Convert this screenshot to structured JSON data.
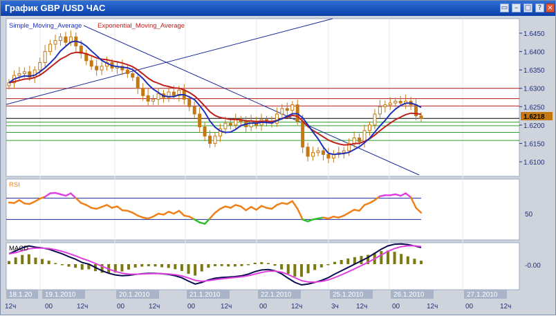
{
  "window": {
    "title": "График GBP /USD  ЧАС",
    "buttons": [
      "restore-window-icon",
      "minimize-window-icon",
      "maximize-window-icon",
      "help-icon",
      "close-window-icon"
    ]
  },
  "main_panel": {
    "legend_sma": "Simple_Moving_Average",
    "legend_ema": "Exponential_Moving_Average",
    "price_ticks": [
      "1.6450",
      "1.6400",
      "1.6350",
      "1.6300",
      "1.6250",
      "1.6200",
      "1.6150",
      "1.6100"
    ],
    "current_price": "1.6218",
    "sma_color": "#1f2fb8",
    "ema_color": "#c0201c",
    "candle_color": "#c47812",
    "red_levels": [
      1.63,
      1.6272,
      1.6252
    ],
    "green_levels": [
      1.6208,
      1.6198,
      1.618,
      1.6158
    ]
  },
  "rsi_panel": {
    "label": "RSI",
    "tick": "50",
    "upper_level": 72,
    "lower_level": 28,
    "overbought_color": "#e040e0",
    "oversold_color": "#30c030",
    "line_color": "#f08018"
  },
  "macd_panel": {
    "label": "MACD",
    "tick": "-0.00",
    "hist_color": "#7a7a10"
  },
  "time_axis": {
    "dates": [
      "18.1.20",
      "19.1.2010",
      "20.1.2010",
      "21.1.2010",
      "22.1.2010",
      "25.1.2010",
      "26.1.2010",
      "27.1.2010"
    ],
    "hours": [
      "12ч",
      "00",
      "12ч",
      "00",
      "12ч",
      "00",
      "12ч",
      "00",
      "12ч",
      "3ч",
      "12ч",
      "00",
      "12ч",
      "00",
      "12ч"
    ]
  },
  "chart_data": {
    "type": "line",
    "instrument": "GBP/USD",
    "close": [
      1.6315,
      1.6335,
      1.634,
      1.6345,
      1.633,
      1.635,
      1.637,
      1.64,
      1.642,
      1.643,
      1.644,
      1.6425,
      1.644,
      1.6415,
      1.6395,
      1.6375,
      1.636,
      1.635,
      1.636,
      1.637,
      1.6355,
      1.636,
      1.635,
      1.634,
      1.633,
      1.63,
      1.628,
      1.6265,
      1.627,
      1.6285,
      1.6275,
      1.629,
      1.628,
      1.6295,
      1.627,
      1.625,
      1.623,
      1.6195,
      1.617,
      1.615,
      1.617,
      1.619,
      1.6205,
      1.62,
      1.6215,
      1.621,
      1.6195,
      1.621,
      1.62,
      1.6215,
      1.621,
      1.6205,
      1.623,
      1.6245,
      1.624,
      1.6255,
      1.621,
      1.614,
      1.6115,
      1.6125,
      1.613,
      1.612,
      1.611,
      1.612,
      1.6125,
      1.613,
      1.615,
      1.6165,
      1.6155,
      1.6185,
      1.62,
      1.623,
      1.625,
      1.6255,
      1.626,
      1.6265,
      1.626,
      1.6265,
      1.6255,
      1.6225,
      1.6218
    ],
    "rsi": [
      63,
      62,
      68,
      61,
      60,
      65,
      71,
      75,
      82,
      83,
      80,
      77,
      82,
      72,
      62,
      58,
      52,
      50,
      54,
      58,
      52,
      55,
      47,
      46,
      42,
      36,
      32,
      30,
      34,
      40,
      38,
      44,
      40,
      46,
      36,
      34,
      28,
      22,
      19,
      30,
      42,
      50,
      55,
      52,
      58,
      55,
      47,
      54,
      48,
      56,
      52,
      50,
      58,
      62,
      60,
      66,
      50,
      28,
      24,
      28,
      30,
      32,
      30,
      34,
      32,
      36,
      42,
      48,
      46,
      58,
      62,
      68,
      76,
      78,
      78,
      80,
      77,
      82,
      74,
      52,
      42
    ],
    "macd": [
      0.00062,
      0.0008,
      0.00098,
      0.0011,
      0.00102,
      0.00098,
      0.0009,
      0.00076,
      0.00062,
      0.00045,
      0.0003,
      0.0001,
      0.0,
      -0.0002,
      -0.0004,
      -0.00055,
      -0.00065,
      -0.0007,
      -0.00068,
      -0.00062,
      -0.00058,
      -0.00055,
      -0.00055,
      -0.00058,
      -0.00062,
      -0.0007,
      -0.00082,
      -0.00102,
      -0.0012,
      -0.0011,
      -0.00095,
      -0.00085,
      -0.0008,
      -0.00078,
      -0.00075,
      -0.0007,
      -0.0006,
      -0.00045,
      -0.00035,
      -0.00032,
      -0.0004,
      -0.00058,
      -0.00085,
      -0.0011,
      -0.00125,
      -0.0012,
      -0.0011,
      -0.00098,
      -0.00082,
      -0.0006,
      -0.0004,
      -0.0002,
      0.0,
      0.0002,
      0.0004,
      0.00065,
      0.0009,
      0.0011,
      0.0012,
      0.00122,
      0.00118,
      0.0011,
      0.001
    ]
  }
}
